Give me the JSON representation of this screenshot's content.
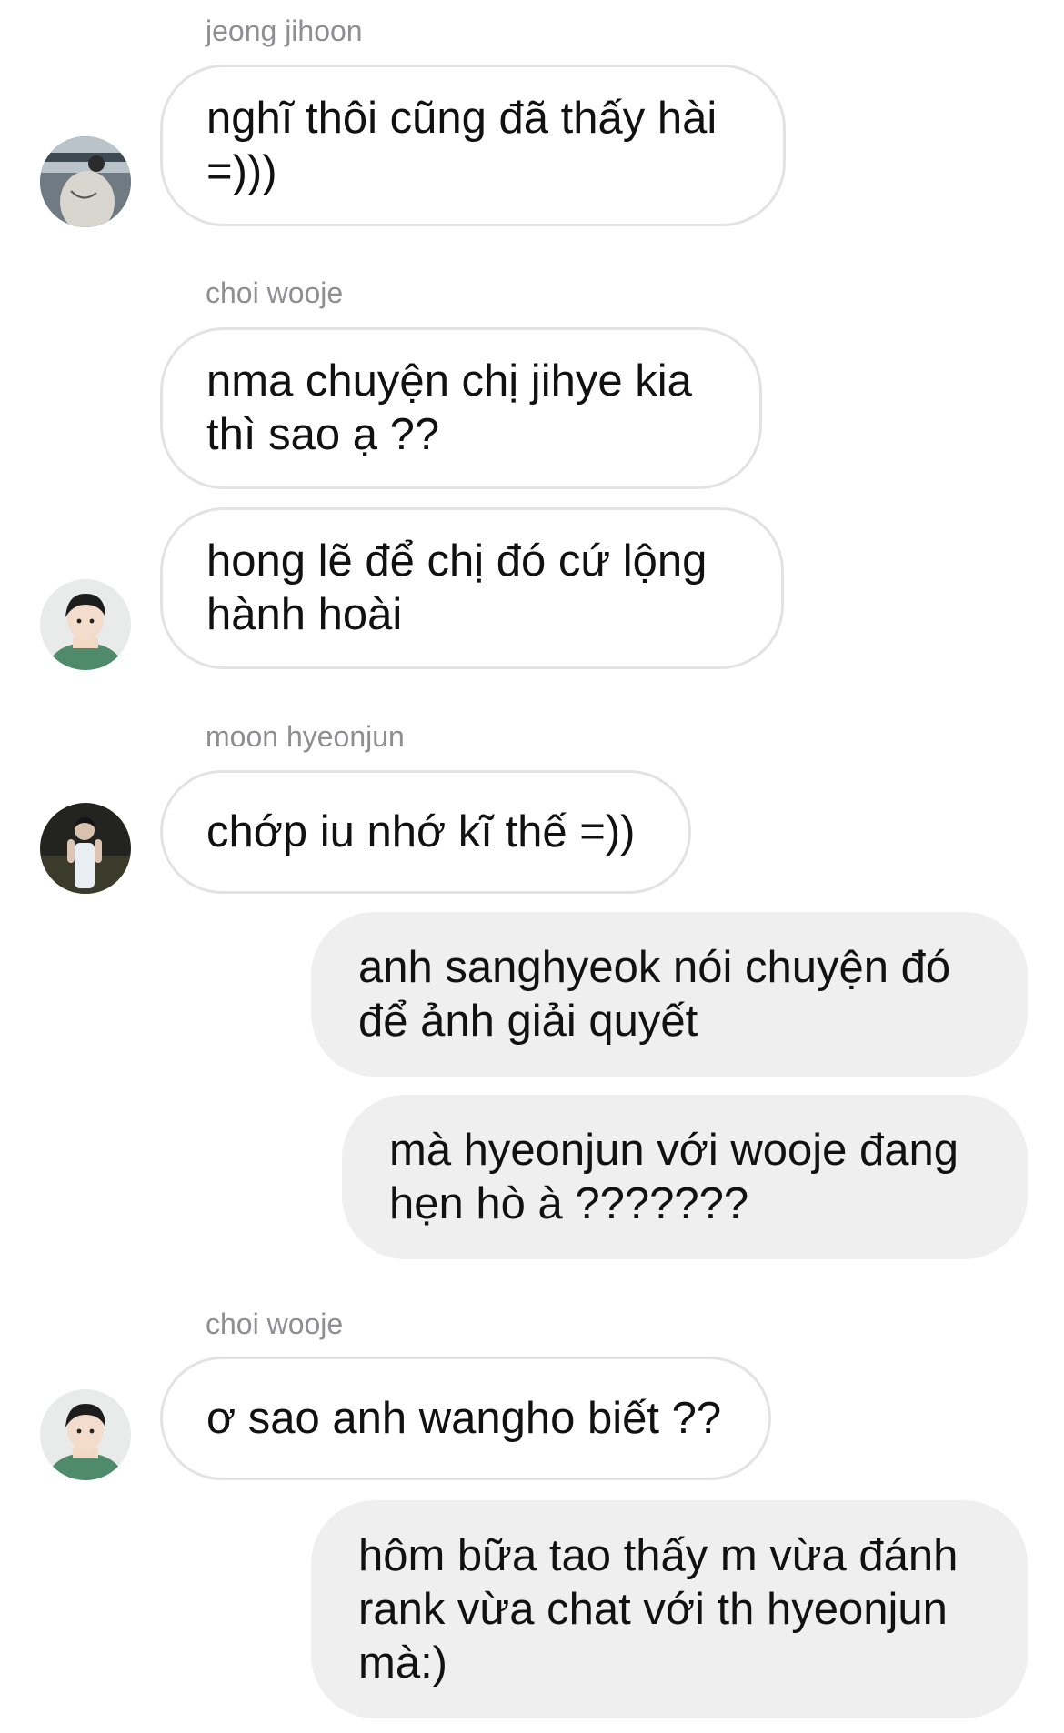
{
  "messages": [
    {
      "sender": "jeong jihoon",
      "text": "nghĩ thôi cũng đã thấy hài =)))"
    },
    {
      "sender": "choi wooje",
      "text": "nma chuyện chị jihye kia thì sao ạ ??"
    },
    {
      "text": "hong lẽ để chị đó cứ lộng hành hoài"
    },
    {
      "sender": "moon hyeonjun",
      "text": "chớp iu nhớ kĩ thế =))"
    },
    {
      "text": "anh sanghyeok nói chuyện đó để ảnh giải quyết"
    },
    {
      "text": "mà hyeonjun với wooje đang hẹn hò à ???????"
    },
    {
      "sender": "choi wooje",
      "text": "ơ sao anh wangho biết ??"
    },
    {
      "text": "hôm bữa tao thấy m vừa đánh rank vừa chat với th hyeonjun mà:)"
    }
  ],
  "avatars": {
    "jeong_jihoon": "avatar-photo",
    "choi_wooje": "avatar-photo",
    "moon_hyeonjun": "avatar-photo"
  },
  "colors": {
    "incoming_border": "#e3e3e6",
    "outgoing_bg": "#efefef",
    "sender_name": "#8e8e93"
  }
}
